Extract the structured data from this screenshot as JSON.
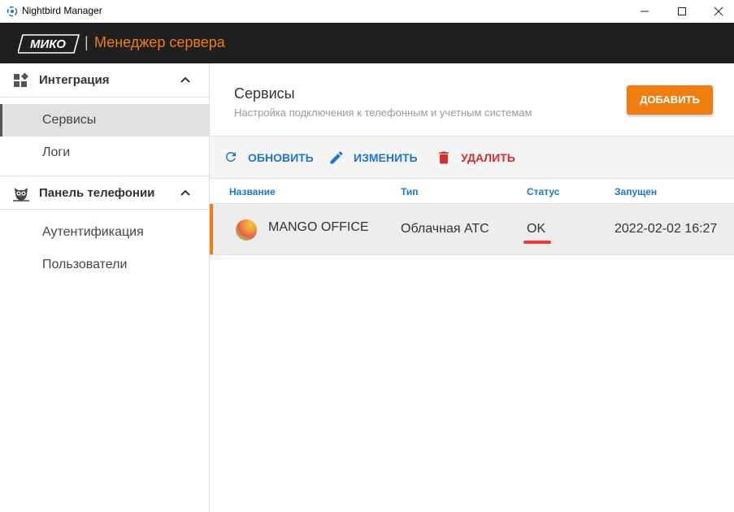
{
  "window": {
    "title": "Nightbird Manager"
  },
  "appbar": {
    "logo_text": "МИКО",
    "separator": "|",
    "title": "Менеджер сервера"
  },
  "sidebar": {
    "sections": [
      {
        "label": "Интеграция",
        "icon": "widgets-icon",
        "items": [
          {
            "label": "Сервисы",
            "active": true
          },
          {
            "label": "Логи",
            "active": false
          }
        ]
      },
      {
        "label": "Панель телефонии",
        "icon": "owl-icon",
        "items": [
          {
            "label": "Аутентификация",
            "active": false
          },
          {
            "label": "Пользователи",
            "active": false
          }
        ]
      }
    ]
  },
  "main": {
    "title": "Сервисы",
    "subtitle": "Настройка подключения к телефонным и учетным системам",
    "add_label": "ДОБАВИТЬ",
    "toolbar": {
      "refresh_label": "ОБНОВИТЬ",
      "edit_label": "ИЗМЕНИТЬ",
      "delete_label": "УДАЛИТЬ"
    },
    "table": {
      "columns": [
        "Название",
        "Тип",
        "Статус",
        "Запущен"
      ],
      "rows": [
        {
          "name": "MANGO OFFICE",
          "type": "Облачная АТС",
          "status": "OK",
          "started": "2022-02-02 16:27"
        }
      ]
    }
  },
  "colors": {
    "accent": "#f07d12",
    "header_bg": "#1f1f1f",
    "link_blue": "#1c76d2",
    "danger_red": "#d32f2f",
    "status_ok_underline": "#ea3b3b"
  }
}
